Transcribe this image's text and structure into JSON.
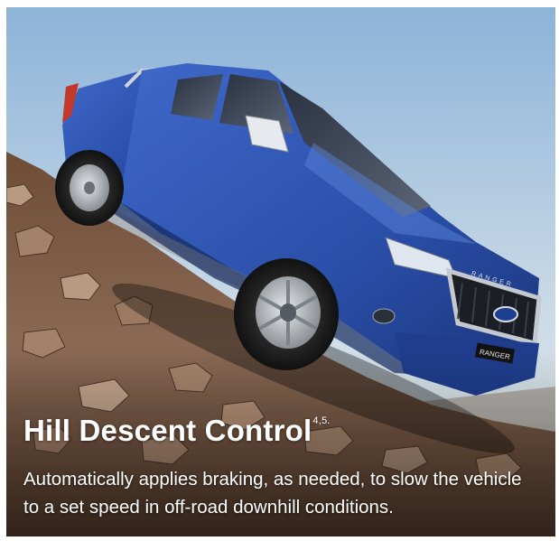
{
  "caption": {
    "title": "Hill Descent Control",
    "superscript": "4,5.",
    "body": "Automatically applies braking, as needed, to slow the vehicle to a set speed in off-road downhill conditions."
  },
  "photo": {
    "subject": "truck-on-rocky-slope",
    "grille_badge": "RANGER",
    "plate_text": "RANGER"
  },
  "colors": {
    "sky_top": "#8db3d8",
    "sky_bottom": "#e9eef0",
    "truck_body": "#2e55b3",
    "rock": "#8a6a55"
  }
}
